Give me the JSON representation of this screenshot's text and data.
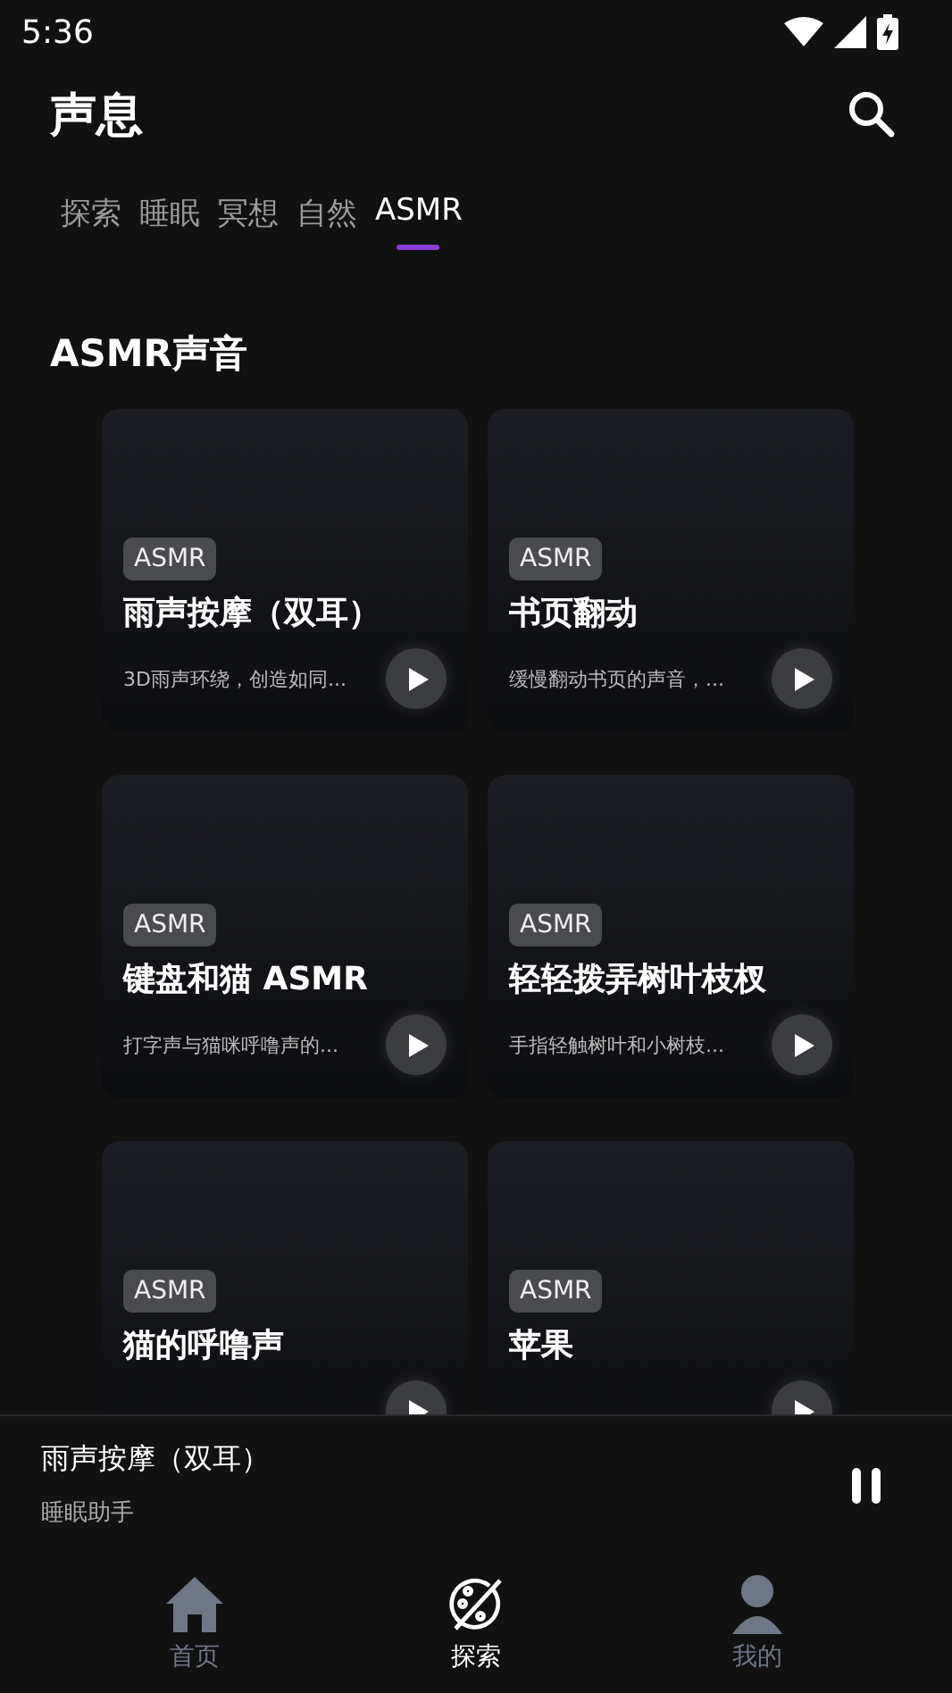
{
  "status_bar": {
    "time": "5:36"
  },
  "header": {
    "title": "声息"
  },
  "tabs": [
    {
      "label": "探索",
      "selected": false
    },
    {
      "label": "睡眠",
      "selected": false
    },
    {
      "label": "冥想",
      "selected": false
    },
    {
      "label": "自然",
      "selected": false
    },
    {
      "label": "ASMR",
      "selected": true
    }
  ],
  "section": {
    "title": "ASMR声音"
  },
  "cards": [
    {
      "tag": "ASMR",
      "title": "雨声按摩（双耳）",
      "description": "3D雨声环绕，创造如同..."
    },
    {
      "tag": "ASMR",
      "title": "书页翻动",
      "description": "缓慢翻动书页的声音，..."
    },
    {
      "tag": "ASMR",
      "title": "键盘和猫 ASMR",
      "description": "打字声与猫咪呼噜声的..."
    },
    {
      "tag": "ASMR",
      "title": "轻轻拨弄树叶枝杈",
      "description": "手指轻触树叶和小树枝..."
    },
    {
      "tag": "ASMR",
      "title": "猫的呼噜声"
    },
    {
      "tag": "ASMR",
      "title": "苹果"
    }
  ],
  "player": {
    "title": "雨声按摩（双耳）",
    "subtitle": "睡眠助手",
    "playing": true
  },
  "bottom_nav": [
    {
      "label": "首页",
      "selected": false
    },
    {
      "label": "探索",
      "selected": true
    },
    {
      "label": "我的",
      "selected": false
    }
  ]
}
